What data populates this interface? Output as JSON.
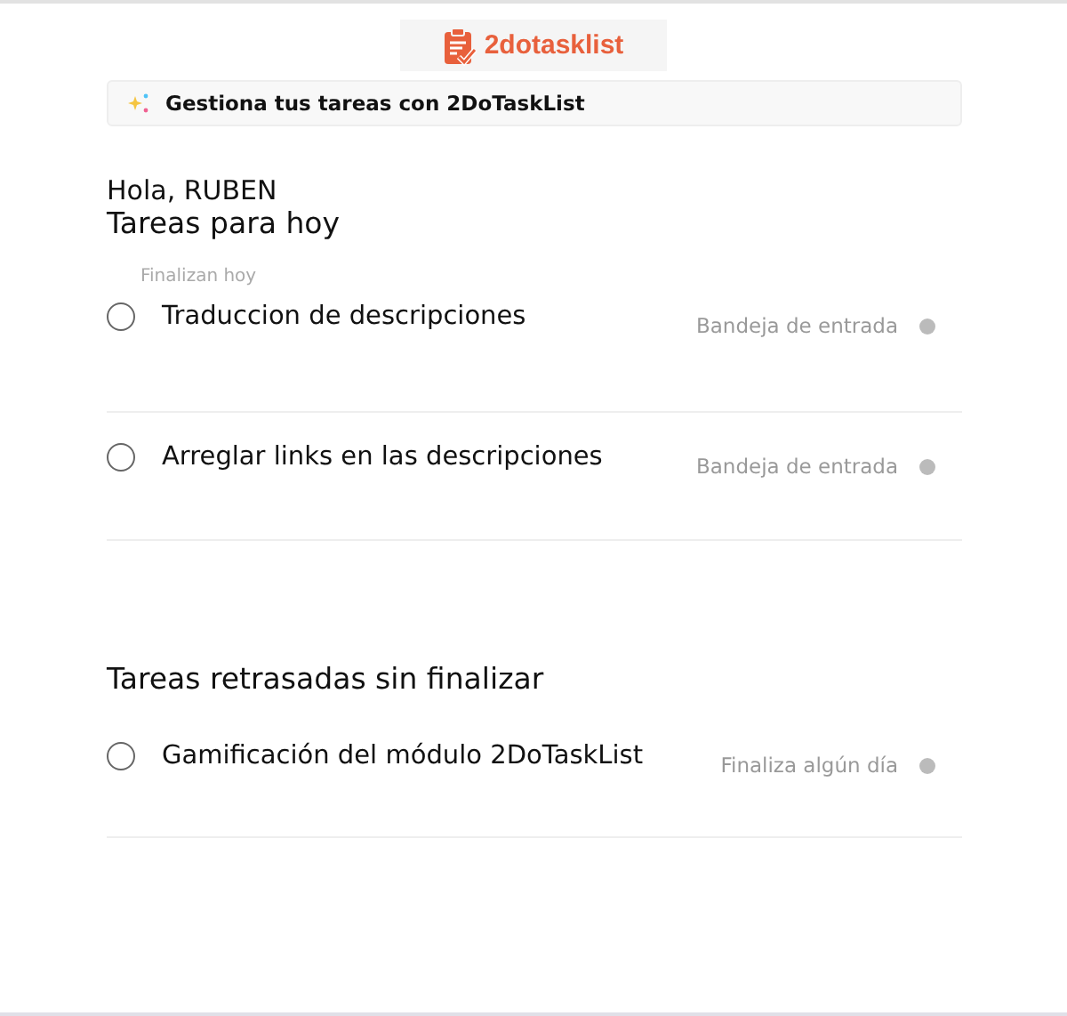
{
  "logo": {
    "text": "2dotasklist"
  },
  "banner": {
    "text": "Gestiona tus tareas con 2DoTaskList"
  },
  "greeting": "Hola, RUBEN",
  "sections": [
    {
      "title": "Tareas para hoy",
      "subtitle": "Finalizan hoy",
      "tasks": [
        {
          "title": "Traduccion de descripciones",
          "project": "Bandeja de entrada",
          "color": "#bbbbbb",
          "checked": false
        },
        {
          "title": "Arreglar links en las descripciones",
          "project": "Bandeja de entrada",
          "color": "#bbbbbb",
          "checked": false
        }
      ]
    },
    {
      "title": "Tareas retrasadas sin finalizar",
      "tasks": [
        {
          "title": "Gamificación del módulo 2DoTaskList",
          "project": "Finaliza algún día",
          "color": "#bbbbbb",
          "checked": false
        }
      ]
    }
  ]
}
